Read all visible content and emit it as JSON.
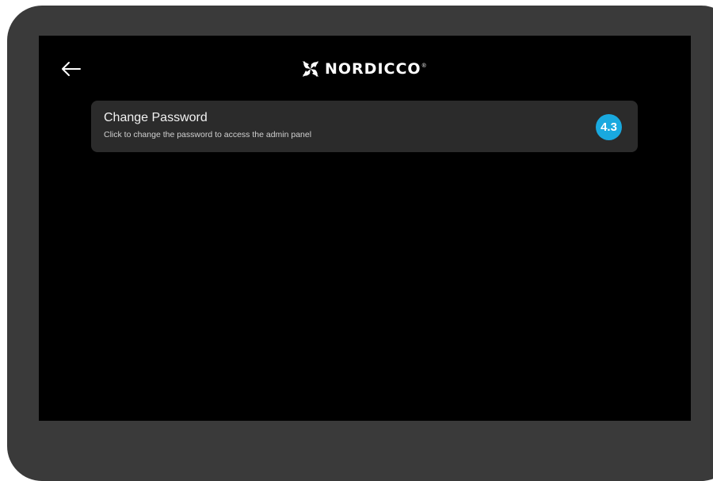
{
  "header": {
    "back_icon": "arrow-left-icon",
    "brand_name": "NORDICCO",
    "brand_reg": "®",
    "logo_icon": "pinwheel-logo-icon"
  },
  "settings": {
    "items": [
      {
        "title": "Change Password",
        "description": "Click to change the password to access the admin panel",
        "badge": "4.3"
      }
    ]
  },
  "colors": {
    "screen_background": "#000000",
    "device_frame": "#3a3a3a",
    "row_background": "#2b2b2b",
    "badge": "#19a9df",
    "text": "#ffffff"
  }
}
